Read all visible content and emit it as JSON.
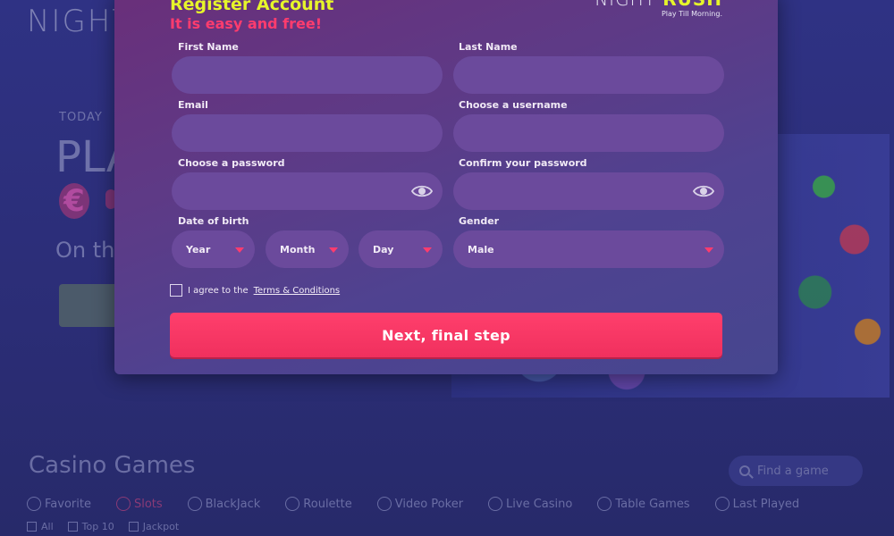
{
  "background": {
    "logo": "NIGHT",
    "today": "TODAY",
    "play": "PLA",
    "on_the": "On th",
    "games_title": "Casino Games",
    "search_placeholder": "Find a game",
    "categories": [
      {
        "label": "Favorite",
        "icon": "star-icon"
      },
      {
        "label": "Slots",
        "icon": "slots-icon",
        "active": true
      },
      {
        "label": "BlackJack",
        "icon": "cards-icon"
      },
      {
        "label": "Roulette",
        "icon": "roulette-icon"
      },
      {
        "label": "Video Poker",
        "icon": "poker-chip-icon"
      },
      {
        "label": "Live Casino",
        "icon": "dealer-icon"
      },
      {
        "label": "Table Games",
        "icon": "table-icon"
      },
      {
        "label": "Last Played",
        "icon": "back-arrow-icon"
      }
    ],
    "filters": [
      "All",
      "Top 10",
      "Jackpot"
    ]
  },
  "modal": {
    "title": "Register Account",
    "subtitle": "It is easy and free!",
    "brand_name_light": "NIGHT",
    "brand_name_bold": "RUSH",
    "brand_tagline": "Play Till Morning.",
    "fields": {
      "first_name": {
        "label": "First Name",
        "value": ""
      },
      "last_name": {
        "label": "Last Name",
        "value": ""
      },
      "email": {
        "label": "Email",
        "value": ""
      },
      "username": {
        "label": "Choose a username",
        "value": ""
      },
      "password": {
        "label": "Choose a password",
        "value": ""
      },
      "confirm_password": {
        "label": "Confirm your password",
        "value": ""
      },
      "dob": {
        "label": "Date of birth",
        "year": "Year",
        "month": "Month",
        "day": "Day"
      },
      "gender": {
        "label": "Gender",
        "value": "Male"
      }
    },
    "terms_prefix": "I agree to the",
    "terms_link": "Terms & Conditions",
    "submit_label": "Next, final step"
  },
  "colors": {
    "accent_yellow": "#e6f52a",
    "accent_pink": "#ff3c6e",
    "field_bg": "#6b4a9c"
  }
}
